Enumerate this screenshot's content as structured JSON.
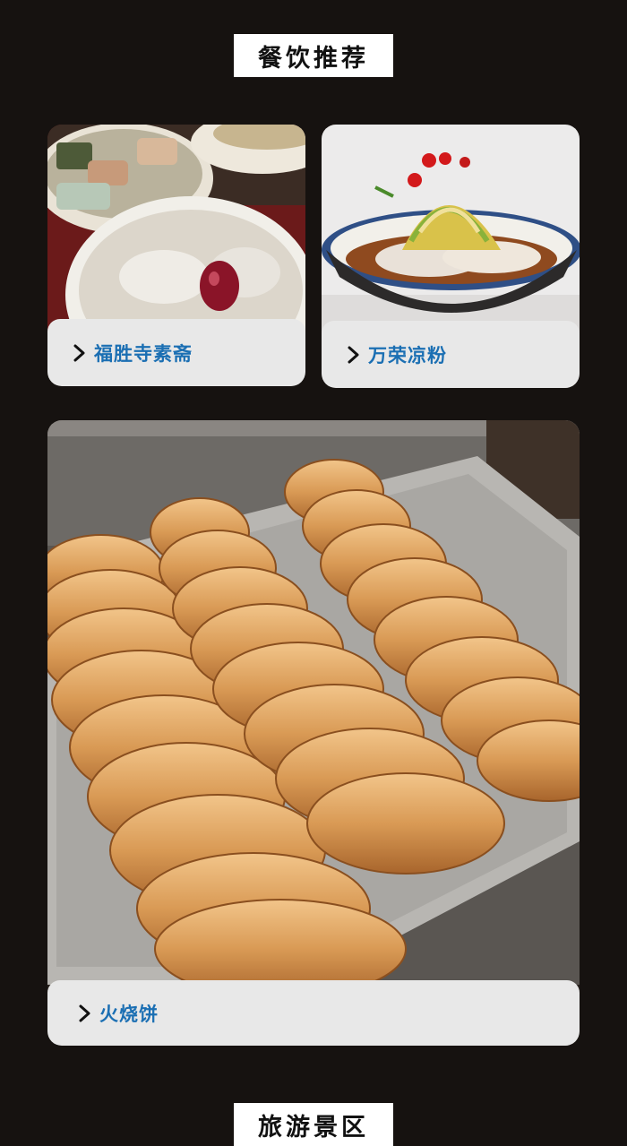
{
  "section": {
    "title": "餐饮推荐",
    "next_title": "旅游景区"
  },
  "cards": [
    {
      "label": "福胜寺素斋",
      "icon": "chevron-right-icon",
      "photo": "soup-bowls-photo"
    },
    {
      "label": "万荣凉粉",
      "icon": "chevron-right-icon",
      "photo": "cold-noodles-photo"
    },
    {
      "label": "火烧饼",
      "icon": "chevron-right-icon",
      "photo": "flatbread-tray-photo"
    }
  ],
  "colors": {
    "background": "#161210",
    "label_bg": "#e8e8e8",
    "label_text": "#1b6fb3"
  }
}
